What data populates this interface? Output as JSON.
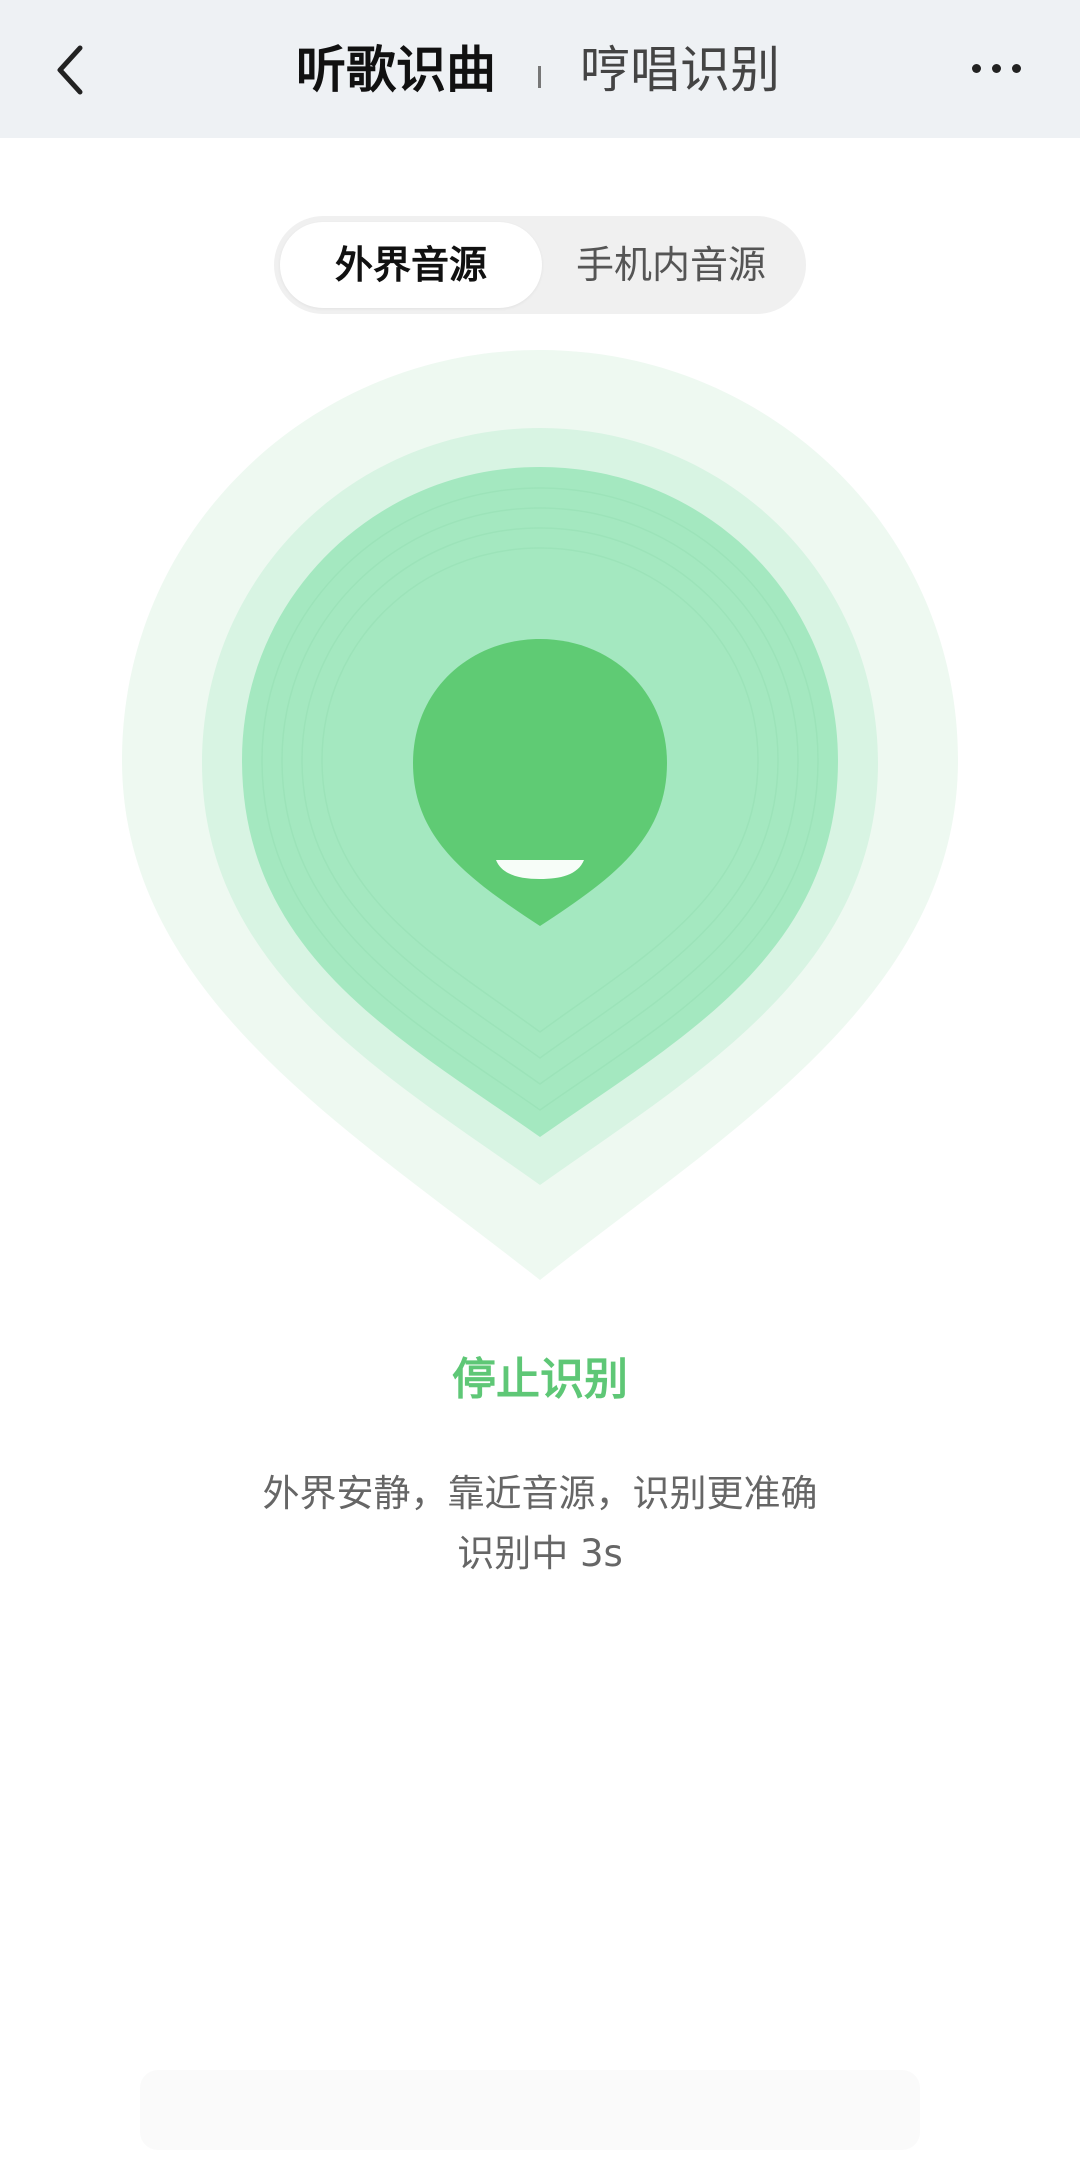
{
  "header": {
    "tabs": [
      {
        "label": "听歌识曲",
        "active": true
      },
      {
        "label": "哼唱识别",
        "active": false
      }
    ],
    "icons": {
      "back": "chevron-left-icon",
      "more": "more-horizontal-icon"
    }
  },
  "source_toggle": {
    "options": [
      {
        "label": "外界音源",
        "selected": true
      },
      {
        "label": "手机内音源",
        "selected": false
      }
    ]
  },
  "recognizer": {
    "icon": "drop-listening-icon",
    "stop_label": "停止识别",
    "hint": "外界安静，靠近音源，识别更准确",
    "status": "识别中 3s"
  },
  "colors": {
    "accent": "#5ec776",
    "drop_core": "#5fcb74",
    "ring_inner": "#a4e8c0",
    "ring_mid": "#d8f4e3",
    "ring_outer": "#eef9f1",
    "topbar_bg": "#eef1f4"
  }
}
